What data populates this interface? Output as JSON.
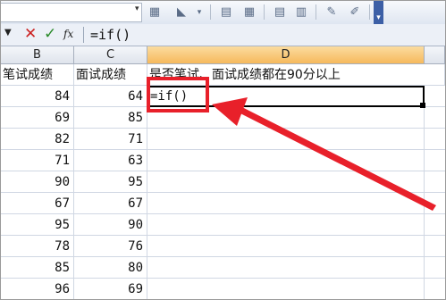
{
  "formula_bar": {
    "cancel_symbol": "✕",
    "enter_symbol": "✓",
    "fx_label": "fx",
    "formula_text": "=if()"
  },
  "columns": [
    {
      "letter": "B",
      "header": "笔试成绩"
    },
    {
      "letter": "C",
      "header": "面试成绩"
    },
    {
      "letter": "D",
      "header": "是否笔试、面试成绩都在90分以上"
    }
  ],
  "rows": [
    {
      "b": "84",
      "c": "64"
    },
    {
      "b": "69",
      "c": "85"
    },
    {
      "b": "82",
      "c": "71"
    },
    {
      "b": "71",
      "c": "63"
    },
    {
      "b": "90",
      "c": "95"
    },
    {
      "b": "67",
      "c": "67"
    },
    {
      "b": "95",
      "c": "90"
    },
    {
      "b": "78",
      "c": "76"
    },
    {
      "b": "85",
      "c": "80"
    },
    {
      "b": "96",
      "c": "69"
    }
  ],
  "active_cell_text": "=if()",
  "colors": {
    "highlight": "#e8202a",
    "active_header": "#f6b95c"
  }
}
